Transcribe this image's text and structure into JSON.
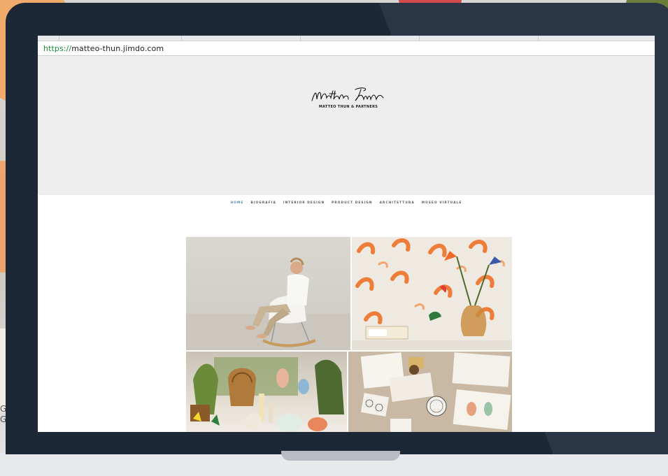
{
  "browser": {
    "url_scheme": "https://",
    "url_rest": "matteo-thun.jimdo.com"
  },
  "site": {
    "logo_signature_text": "matteo Thun",
    "logo_subtitle": "MATTEO THUN & PARTNERS",
    "nav": [
      "HOME",
      "BIOGRAFIA",
      "INTERIOR DESIGN",
      "PRODUCT DESIGN",
      "ARCHITETTURA",
      "MUSEO VIRTUALE"
    ],
    "nav_active_index": 0
  },
  "background": {
    "side_text_lines": [
      "G",
      "G"
    ]
  },
  "colors": {
    "laptop_frame": "#1d2836",
    "nav_active": "#4a8ab5",
    "url_scheme": "#1d8a3c"
  }
}
